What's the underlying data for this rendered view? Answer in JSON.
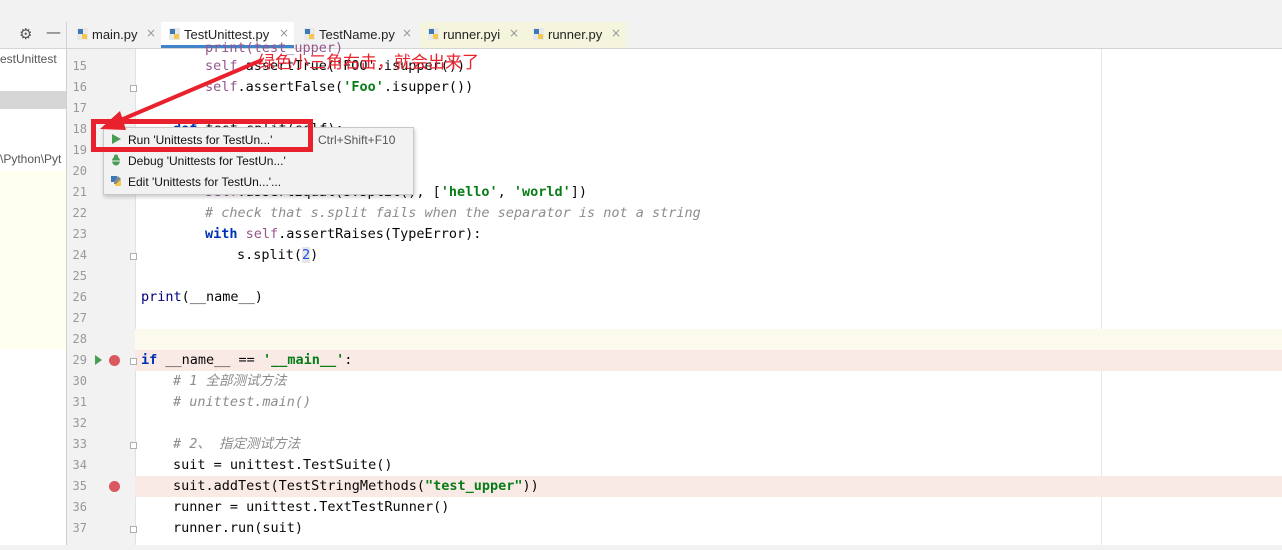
{
  "toolbar": {
    "settings_icon": "gear-icon",
    "minimize_icon": "minimize-icon"
  },
  "project_panel": {
    "text_1": "estUnittest",
    "text_2": "\\Python\\Pyt"
  },
  "tabs": [
    {
      "name": "main.py",
      "close": "×"
    },
    {
      "name": "TestUnittest.py",
      "close": "×"
    },
    {
      "name": "TestName.py",
      "close": "×"
    },
    {
      "name": "runner.pyi",
      "close": "×"
    },
    {
      "name": "runner.py",
      "close": "×"
    }
  ],
  "code_lines": [
    {
      "n": "15"
    },
    {
      "n": "16"
    },
    {
      "n": "17"
    },
    {
      "n": "18"
    },
    {
      "n": "19"
    },
    {
      "n": "20"
    },
    {
      "n": "21"
    },
    {
      "n": "22"
    },
    {
      "n": "23"
    },
    {
      "n": "24"
    },
    {
      "n": "25"
    },
    {
      "n": "26"
    },
    {
      "n": "27"
    },
    {
      "n": "28"
    },
    {
      "n": "29"
    },
    {
      "n": "30"
    },
    {
      "n": "31"
    },
    {
      "n": "32"
    },
    {
      "n": "33"
    },
    {
      "n": "34"
    },
    {
      "n": "35"
    },
    {
      "n": "36"
    },
    {
      "n": "37"
    }
  ],
  "code": {
    "l14_tail": "print(test_upper)",
    "l15": {
      "self": "self",
      "rest": ".assertTrue('FOO'.isupper())"
    },
    "l16": {
      "self": "self",
      "rest1": ".assertFalse(",
      "str": "'Foo'",
      "rest2": ".isupper())"
    },
    "l18": {
      "kw": "def",
      "rest": " test_split(self):"
    },
    "l21": {
      "self": "self",
      "rest1": ".assertEqual(s.split(), [",
      "s1": "'hello'",
      "sep": ", ",
      "s2": "'world'",
      "rest2": "])"
    },
    "l22": "# check that s.split fails when the separator is not a string",
    "l23": {
      "kw": "with",
      "sp": " ",
      "self": "self",
      "rest": ".assertRaises(TypeError):"
    },
    "l24": {
      "rest1": "s.split(",
      "num": "2",
      "rest2": ")"
    },
    "l26": {
      "fn": "print",
      "rest": "(__name__)"
    },
    "l29": {
      "kw": "if",
      "rest": " __name__ == ",
      "str": "'__main__'",
      "tail": ":"
    },
    "l30": "# 1 全部测试方法",
    "l31": "# unittest.main()",
    "l33": "# 2、 指定测试方法",
    "l34": "suit = unittest.TestSuite()",
    "l35": {
      "rest1": "suit.addTest(TestStringMethods(",
      "str": "\"test_upper\"",
      "rest2": "))"
    },
    "l36": "runner = unittest.TextTestRunner()",
    "l37": "runner.run(suit)"
  },
  "context_menu": {
    "run": {
      "label": "Run 'Unittests for TestUn...'",
      "shortcut": "Ctrl+Shift+F10",
      "icon": "run-icon"
    },
    "debug": {
      "label": "Debug 'Unittests for TestUn...'",
      "icon": "debug-icon"
    },
    "edit": {
      "label": "Edit 'Unittests for TestUn...'...",
      "icon": "edit-config-icon"
    }
  },
  "annotation": {
    "text": "绿色小三角右击，就会出来了",
    "color": "#e8212c"
  },
  "colors": {
    "keyword": "#0033b3",
    "self": "#94558d",
    "string": "#067d17",
    "comment": "#8c8c8c",
    "breakpoint": "#db5860",
    "run": "#499c54",
    "accent": "#4083c9"
  }
}
